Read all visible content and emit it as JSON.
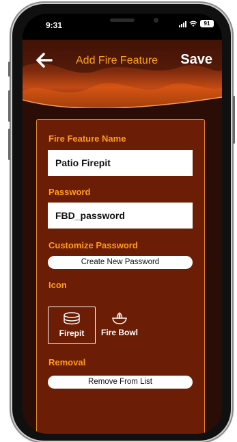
{
  "status": {
    "time": "9:31",
    "battery": "91"
  },
  "header": {
    "title": "Add Fire Feature",
    "save_label": "Save"
  },
  "form": {
    "name_label": "Fire Feature Name",
    "name_value": "Patio Firepit",
    "password_label": "Password",
    "password_value": "FBD_password",
    "customize_label": "Customize Password",
    "create_password_button": "Create New Password",
    "icon_label": "Icon",
    "icons": [
      {
        "label": "Firepit",
        "selected": true
      },
      {
        "label": "Fire Bowl",
        "selected": false
      }
    ],
    "removal_label": "Removal",
    "remove_button": "Remove From List"
  },
  "colors": {
    "accent_orange": "#ff9d16",
    "panel_bg": "#6b1d05",
    "panel_border": "#e08a2a",
    "screen_bg": "#2a0d06"
  }
}
